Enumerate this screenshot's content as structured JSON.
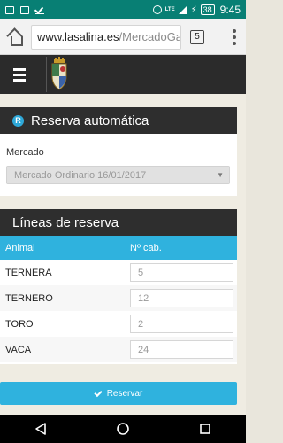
{
  "status_bar": {
    "battery": "38",
    "time": "9:45",
    "network": "LTE"
  },
  "browser": {
    "url_domain": "www.lasalina.es",
    "url_path": "/MercadoGa",
    "tab_count": "5"
  },
  "reserva_panel": {
    "icon_letter": "R",
    "title": "Reserva automática",
    "mercado_label": "Mercado",
    "mercado_value": "Mercado Ordinario 16/01/2017"
  },
  "lineas_panel": {
    "title": "Líneas de reserva",
    "col_animal": "Animal",
    "col_cab": "Nº cab.",
    "rows": [
      {
        "animal": "TERNERA",
        "value": "5"
      },
      {
        "animal": "TERNERO",
        "value": "12"
      },
      {
        "animal": "TORO",
        "value": "2"
      },
      {
        "animal": "VACA",
        "value": "24"
      }
    ]
  },
  "submit_label": "Reservar",
  "colors": {
    "status_bar": "#087f74",
    "header": "#2b2b2b",
    "accent": "#2fb2de"
  }
}
